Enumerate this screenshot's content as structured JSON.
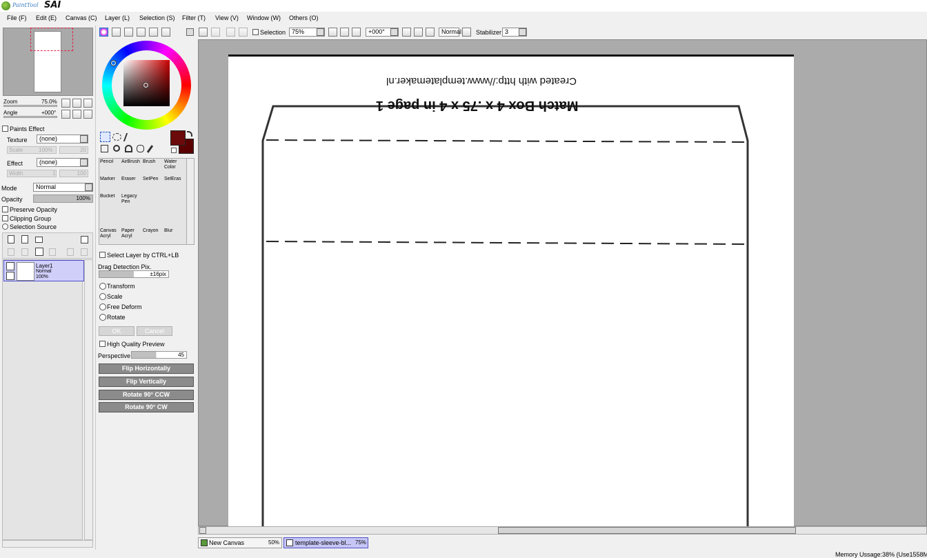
{
  "app": {
    "logo_small": "PaintTool",
    "logo_big": "SAI"
  },
  "menu": [
    "File (F)",
    "Edit (E)",
    "Canvas (C)",
    "Layer (L)",
    "Selection (S)",
    "Filter (T)",
    "View (V)",
    "Window (W)",
    "Others (O)"
  ],
  "navigator": {
    "zoom_label": "Zoom",
    "zoom_value": "75.0%",
    "angle_label": "Angle",
    "angle_value": "+000°"
  },
  "paints_effect": {
    "header": "Paints Effect",
    "texture_label": "Texture",
    "texture_value": "(none)",
    "scale_label": "Scale",
    "scale_value": "100%",
    "scale_num": "20",
    "effect_label": "Effect",
    "effect_value": "(none)",
    "width_label": "Width",
    "width_value": "1",
    "width_num": "100"
  },
  "layer_props": {
    "mode_label": "Mode",
    "mode_value": "Normal",
    "opacity_label": "Opacity",
    "opacity_value": "100%",
    "preserve_opacity": "Preserve Opacity",
    "clipping_group": "Clipping Group",
    "selection_source": "Selection Source"
  },
  "layers": [
    {
      "name": "Layer1",
      "mode": "Normal",
      "opacity": "100%"
    }
  ],
  "colors": {
    "primary": "#6b0a0a",
    "secondary": "#5a0000",
    "accent": "#3060c0"
  },
  "tools": [
    {
      "name": "Pencil",
      "sub": ""
    },
    {
      "name": "AirBrush",
      "sub": ""
    },
    {
      "name": "Brush",
      "sub": ""
    },
    {
      "name": "Water",
      "sub": "Color"
    },
    {
      "name": "Marker",
      "sub": ""
    },
    {
      "name": "Eraser",
      "sub": ""
    },
    {
      "name": "SelPen",
      "sub": ""
    },
    {
      "name": "SelEras",
      "sub": ""
    },
    {
      "name": "Bucket",
      "sub": ""
    },
    {
      "name": "Legacy",
      "sub": "Pen"
    },
    {
      "name": "",
      "sub": ""
    },
    {
      "name": "",
      "sub": ""
    },
    {
      "name": "Canvas",
      "sub": "Acryl"
    },
    {
      "name": "Paper",
      "sub": "Acryl"
    },
    {
      "name": "Crayon",
      "sub": ""
    },
    {
      "name": "Blur",
      "sub": ""
    }
  ],
  "transform": {
    "select_layer": "Select Layer by CTRL+LB",
    "drag_detection": "Drag Detection Pix.",
    "drag_value": "±16pix",
    "options": [
      "Transform",
      "Scale",
      "Free Deform",
      "Rotate"
    ],
    "ok": "OK",
    "cancel": "Cancel",
    "hq_preview": "High Quality Preview",
    "perspective_label": "Perspective",
    "perspective_value": "45",
    "buttons": [
      "Flip Horizontally",
      "Flip Vertically",
      "Rotate 90° CCW",
      "Rotate 90° CW"
    ]
  },
  "toolbar": {
    "selection_label": "Selection",
    "zoom": "75%",
    "angle": "+000°",
    "blend": "Normal",
    "stabilizer_label": "Stabilizer",
    "stabilizer_value": "3"
  },
  "canvas_text": {
    "line1": "Created with http://www.templatemaker.nl",
    "line2": "Match Box 4 x .75 x 4 in page 1"
  },
  "tabs": [
    {
      "name": "New Canvas",
      "zoom": "50%"
    },
    {
      "name": "template-sleeve-bl...",
      "zoom": "75%"
    }
  ],
  "status": "Memory Ussage:38% (Use1558MB/"
}
